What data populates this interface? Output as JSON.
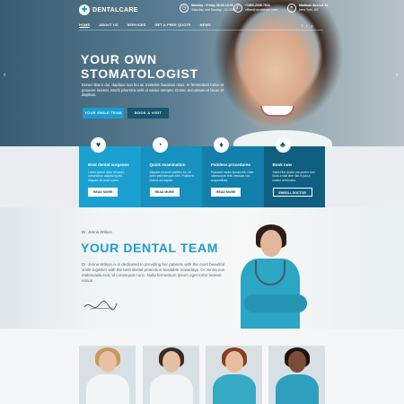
{
  "brand": {
    "name": "DENTALCARE",
    "icon": "tooth-icon"
  },
  "contact": {
    "hours_title": "Monday - Friday 08:00-19:00",
    "hours_sub": "Saturday and Sunday - CLOSED",
    "phone": "+1800-2336-7844",
    "email": "office@dentalcare.com",
    "address_title": "Madison Avenue 11",
    "address_sub": "New York, US"
  },
  "nav": {
    "items": [
      "HOME",
      "ABOUT US",
      "SERVICES",
      "GET A FREE QUOTE",
      "NEWS"
    ],
    "active_index": 0
  },
  "socials": [
    "f",
    "t",
    "g"
  ],
  "hero": {
    "title_line1": "YOUR OWN",
    "title_line2": "STOMATOLOGIST",
    "description": "Donec libero dui, dapibus non leo at, molestie faucibus risus. In fermentum tortor et posuere laoreet. Morbi pharetra velit ut varius semper. Donec accumsan et lacus et dapibus.",
    "primary_button": "YOUR SMILE TEAM",
    "secondary_button": "BOOK A VISIT",
    "prev_arrow": "‹",
    "next_arrow": "›"
  },
  "features": [
    {
      "icon": "tooth-icon",
      "title": "Best dental surgeons",
      "text": "Lorem ipsum dolor sit amet, consectetur adipiscing elit. Aliquam sit amet lorem.",
      "button": "READ MORE"
    },
    {
      "icon": "tooth-icon",
      "title": "Quick examination",
      "text": "Aliquam sit amet porttitor ex, sit amet pellentesque nibh. Praesent viverra dui sapien.",
      "button": "READ MORE"
    },
    {
      "icon": "tooth-icon",
      "title": "Painless procedures",
      "text": "Praesent varius lipsum elit, vitae ullamcorper felis vehicula non suspendisse.",
      "button": "READ MORE"
    },
    {
      "icon": "tooth-icon",
      "title": "Book now",
      "text": "Select the doctor you prefer and book a visit time slot in just a matter of minutes.",
      "button": "ENROLL DOCTOR"
    }
  ],
  "team": {
    "subtitle": "Dr. Jenna Wilson",
    "title": "YOUR DENTAL TEAM",
    "text": "Dr. Jenna Wilson is is dedicated to providing her patients with the most beautiful smile together with the best dental protection available nowadays. Dr Jenna non malesuada erat, id consequat nunc. Nulla fermentum ipsum eget tortor laoreet varius."
  },
  "staff_colors": {
    "skin": [
      "#e9c2a4",
      "#e5bfa2",
      "#e8bd9e",
      "#7a4e36"
    ],
    "hair": [
      "#c79a5a",
      "#3a2a22",
      "#8a3e1e",
      "#1e1512"
    ],
    "scrubs": [
      "#f3f6f7",
      "#f1f4f5",
      "#36a9c4",
      "#2ea0bd"
    ]
  }
}
